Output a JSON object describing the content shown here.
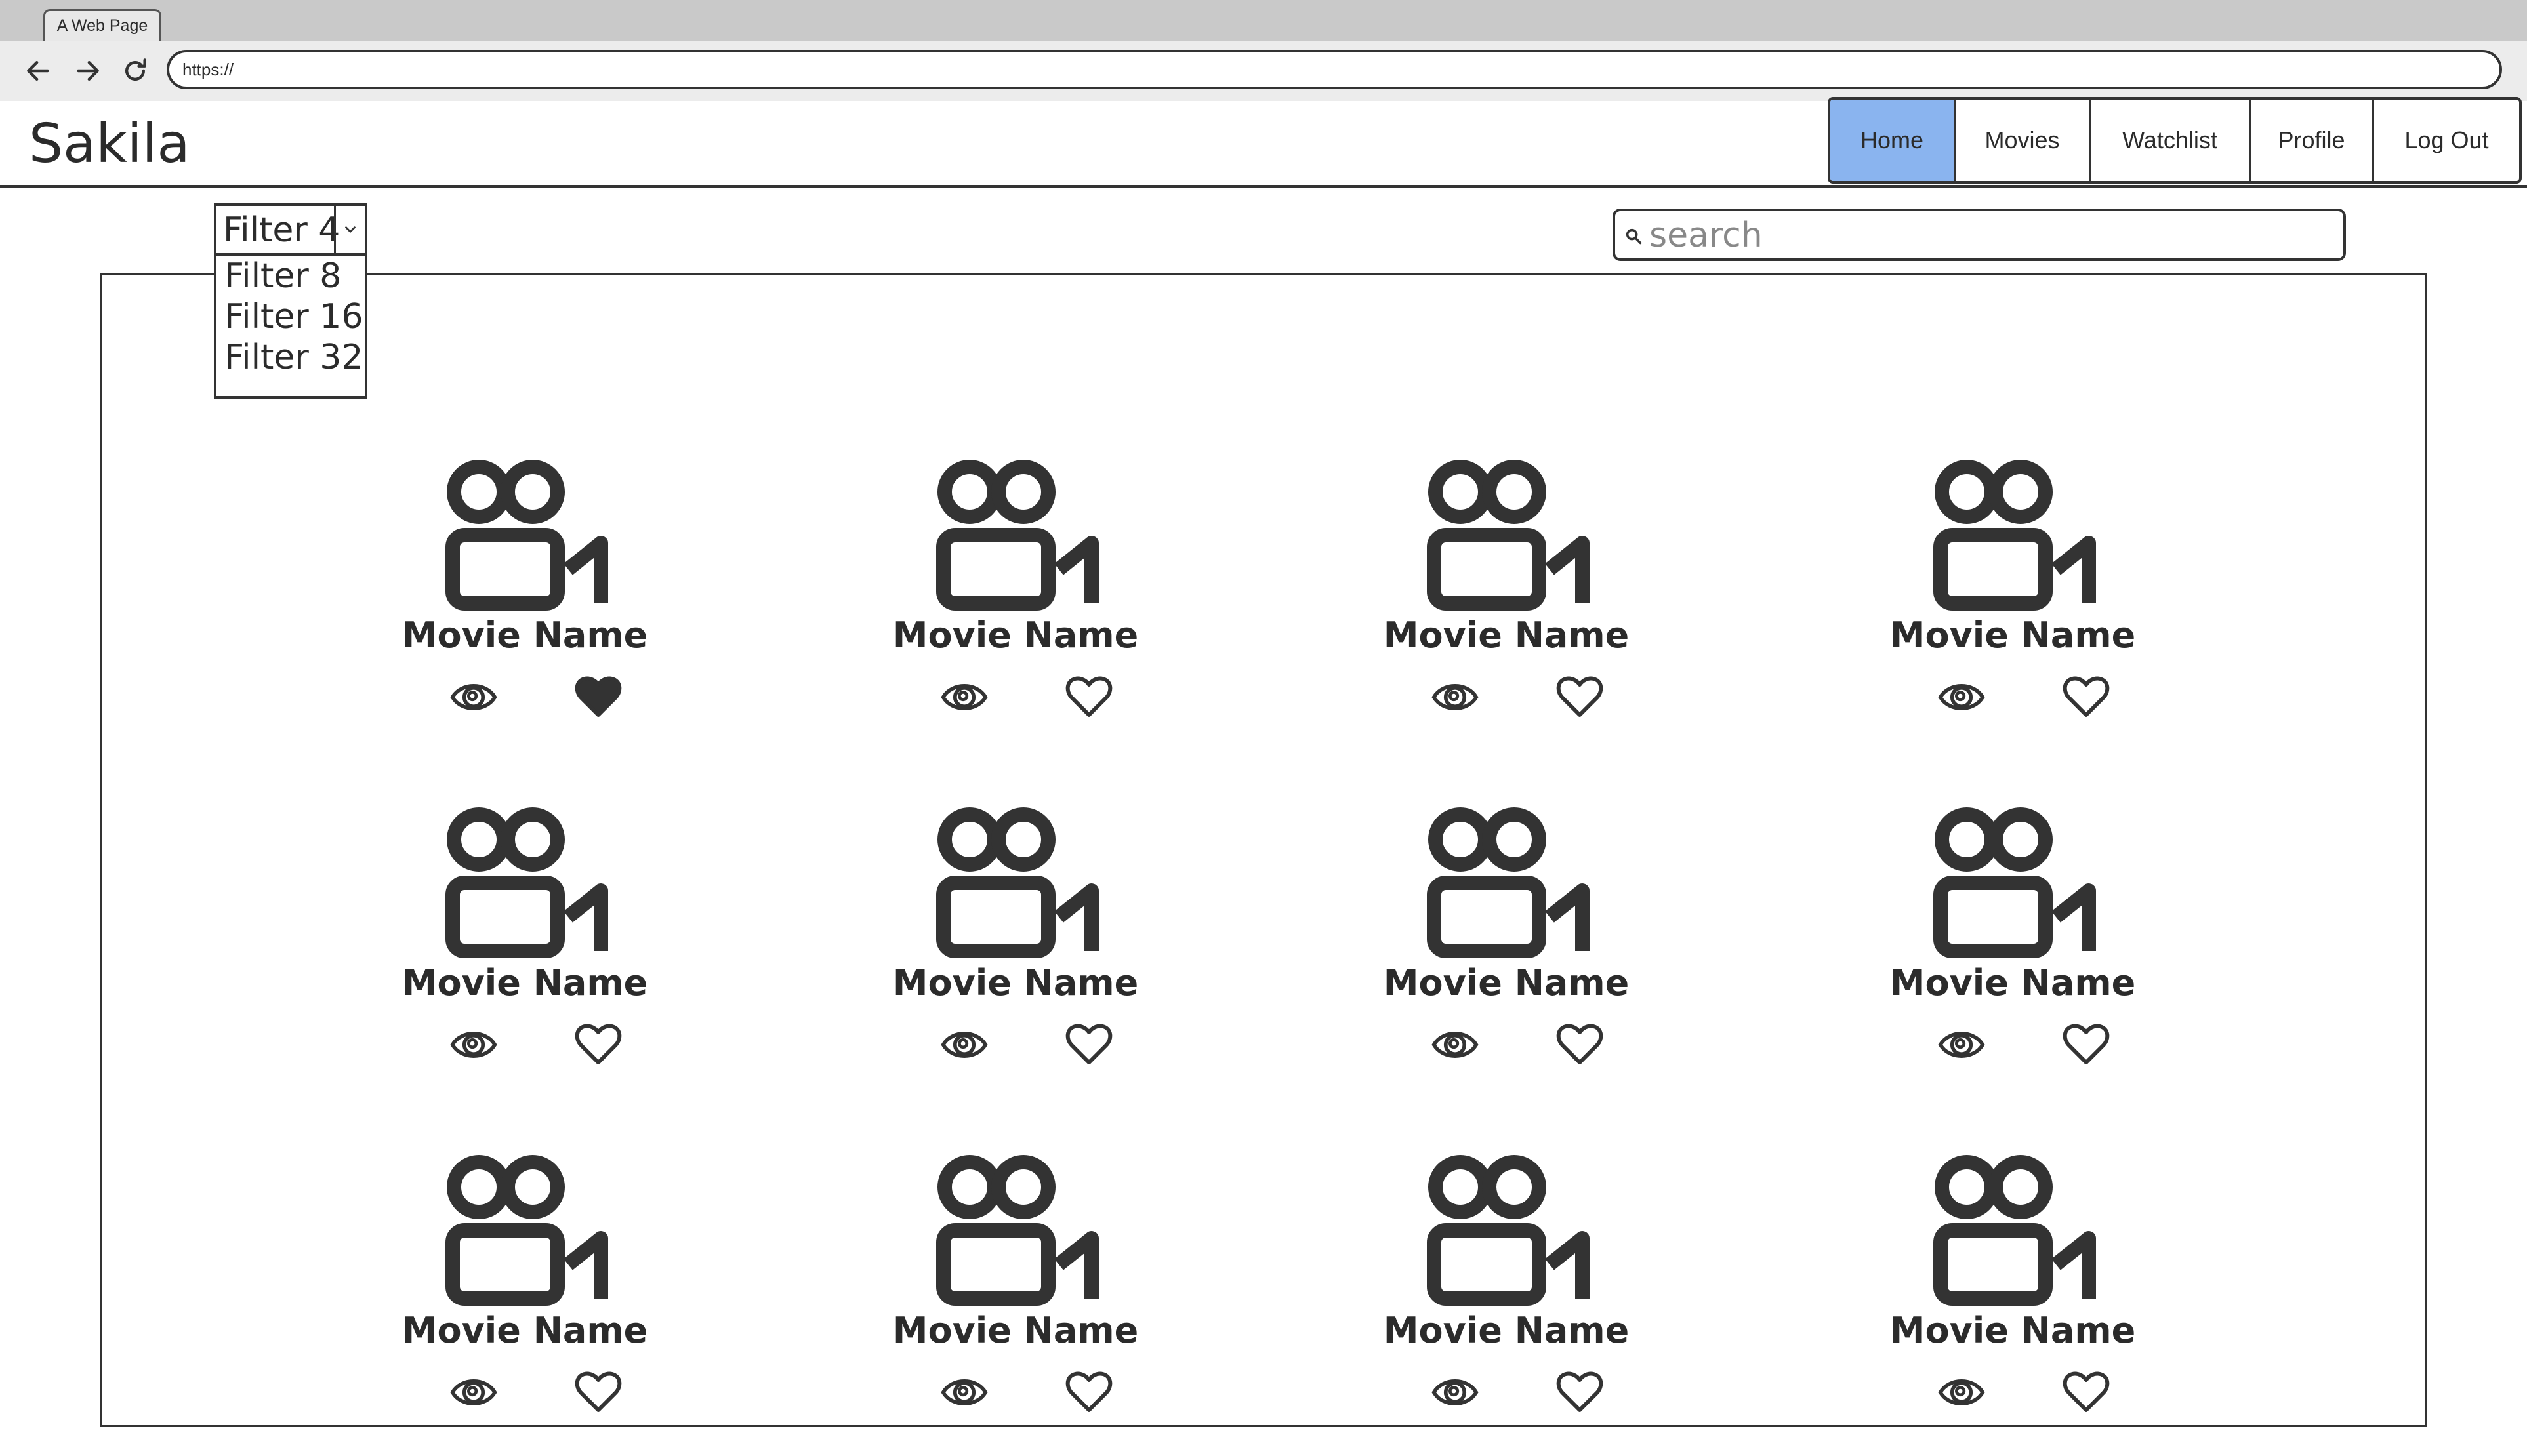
{
  "browser": {
    "tab_title": "A Web Page",
    "url": "https://"
  },
  "header": {
    "logo": "Sakila",
    "nav": [
      {
        "label": "Home",
        "active": true
      },
      {
        "label": "Movies",
        "active": false
      },
      {
        "label": "Watchlist",
        "active": false
      },
      {
        "label": "Profile",
        "active": false
      },
      {
        "label": "Log Out",
        "active": false
      }
    ],
    "active_color": "#8ab4ef"
  },
  "filter": {
    "selected": "Filter 4",
    "options": [
      "Filter 8",
      "Filter 16",
      "Filter 32"
    ]
  },
  "search": {
    "placeholder": "search",
    "value": ""
  },
  "movies": [
    {
      "name": "Movie Name",
      "favorited": true
    },
    {
      "name": "Movie Name",
      "favorited": false
    },
    {
      "name": "Movie Name",
      "favorited": false
    },
    {
      "name": "Movie Name",
      "favorited": false
    },
    {
      "name": "Movie Name",
      "favorited": false
    },
    {
      "name": "Movie Name",
      "favorited": false
    },
    {
      "name": "Movie Name",
      "favorited": false
    },
    {
      "name": "Movie Name",
      "favorited": false
    },
    {
      "name": "Movie Name",
      "favorited": false
    },
    {
      "name": "Movie Name",
      "favorited": false
    },
    {
      "name": "Movie Name",
      "favorited": false
    },
    {
      "name": "Movie Name",
      "favorited": false
    }
  ],
  "icons": {
    "movie": "movie-camera-icon",
    "watch": "eye-icon",
    "favorite": "heart-icon"
  }
}
